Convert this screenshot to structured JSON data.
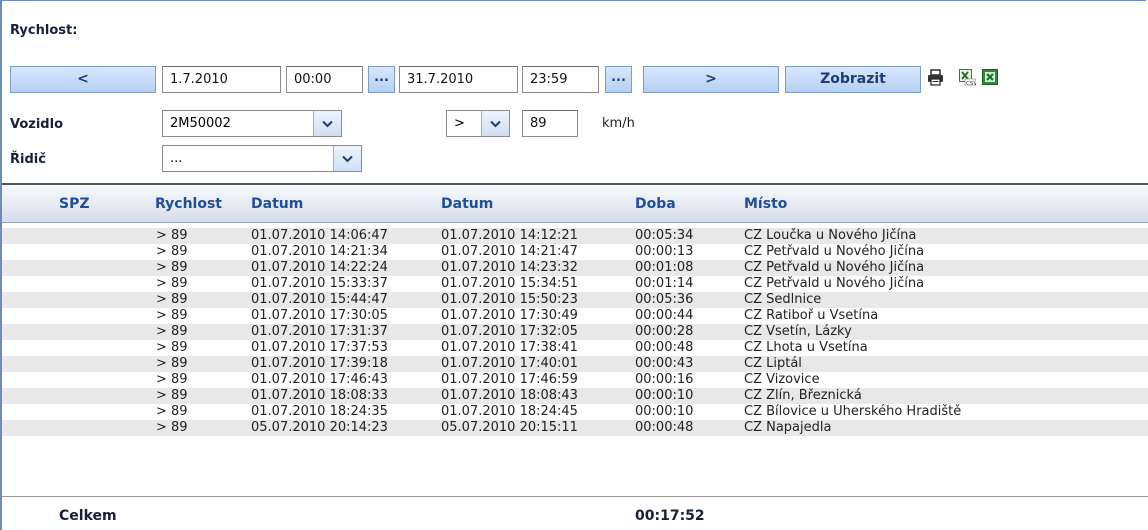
{
  "title": "Rychlost:",
  "toolbar": {
    "prev_label": "<",
    "date_from": "1.7.2010",
    "time_from": "00:00",
    "picker_label": "...",
    "date_to": "31.7.2010",
    "time_to": "23:59",
    "next_label": ">",
    "show_label": "Zobrazit"
  },
  "icons": [
    "printer-icon",
    "excel-csv-icon",
    "excel-icon"
  ],
  "filters": {
    "vehicle_label": "Vozidlo",
    "vehicle_value": "2M50002",
    "operator_value": ">",
    "speed_value": "89",
    "speed_unit": "km/h",
    "driver_label": "Řidič",
    "driver_value": "..."
  },
  "table": {
    "columns": [
      "SPZ",
      "Rychlost",
      "Datum",
      "Datum",
      "Doba",
      "Místo"
    ],
    "rows": [
      {
        "spz": "",
        "speed": "> 89",
        "from": "01.07.2010 14:06:47",
        "to": "01.07.2010 14:12:21",
        "duration": "00:05:34",
        "place": "CZ Loučka u Nového Jičína"
      },
      {
        "spz": "",
        "speed": "> 89",
        "from": "01.07.2010 14:21:34",
        "to": "01.07.2010 14:21:47",
        "duration": "00:00:13",
        "place": "CZ Petřvald u Nového Jičína"
      },
      {
        "spz": "",
        "speed": "> 89",
        "from": "01.07.2010 14:22:24",
        "to": "01.07.2010 14:23:32",
        "duration": "00:01:08",
        "place": "CZ Petřvald u Nového Jičína"
      },
      {
        "spz": "",
        "speed": "> 89",
        "from": "01.07.2010 15:33:37",
        "to": "01.07.2010 15:34:51",
        "duration": "00:01:14",
        "place": "CZ Petřvald u Nového Jičína"
      },
      {
        "spz": "",
        "speed": "> 89",
        "from": "01.07.2010 15:44:47",
        "to": "01.07.2010 15:50:23",
        "duration": "00:05:36",
        "place": "CZ Sedlnice"
      },
      {
        "spz": "",
        "speed": "> 89",
        "from": "01.07.2010 17:30:05",
        "to": "01.07.2010 17:30:49",
        "duration": "00:00:44",
        "place": "CZ Ratiboř u Vsetína"
      },
      {
        "spz": "",
        "speed": "> 89",
        "from": "01.07.2010 17:31:37",
        "to": "01.07.2010 17:32:05",
        "duration": "00:00:28",
        "place": "CZ Vsetín, Lázky"
      },
      {
        "spz": "",
        "speed": "> 89",
        "from": "01.07.2010 17:37:53",
        "to": "01.07.2010 17:38:41",
        "duration": "00:00:48",
        "place": "CZ Lhota u Vsetína"
      },
      {
        "spz": "",
        "speed": "> 89",
        "from": "01.07.2010 17:39:18",
        "to": "01.07.2010 17:40:01",
        "duration": "00:00:43",
        "place": "CZ Liptál"
      },
      {
        "spz": "",
        "speed": "> 89",
        "from": "01.07.2010 17:46:43",
        "to": "01.07.2010 17:46:59",
        "duration": "00:00:16",
        "place": "CZ Vizovice"
      },
      {
        "spz": "",
        "speed": "> 89",
        "from": "01.07.2010 18:08:33",
        "to": "01.07.2010 18:08:43",
        "duration": "00:00:10",
        "place": "CZ Zlín, Březnická"
      },
      {
        "spz": "",
        "speed": "> 89",
        "from": "01.07.2010 18:24:35",
        "to": "01.07.2010 18:24:45",
        "duration": "00:00:10",
        "place": "CZ Bílovice u Uherského Hradiště"
      },
      {
        "spz": "",
        "speed": "> 89",
        "from": "05.07.2010 20:14:23",
        "to": "05.07.2010 20:15:11",
        "duration": "00:00:48",
        "place": "CZ Napajedla"
      }
    ]
  },
  "footer": {
    "total_label": "Celkem",
    "total_value": "00:17:52"
  },
  "colors": {
    "header_text": "#1f4f9c",
    "button_bg": "#c6dbf5",
    "row_alt": "#e8e8e8"
  }
}
